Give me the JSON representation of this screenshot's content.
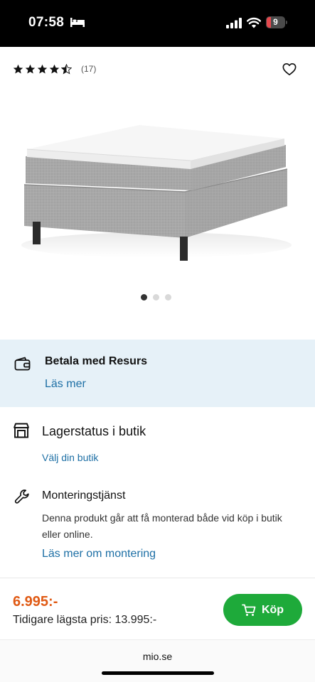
{
  "status_bar": {
    "time": "07:58",
    "battery_level": "9",
    "icons": [
      "bed-icon",
      "signal-icon",
      "wifi-icon",
      "battery-icon"
    ]
  },
  "product": {
    "rating": 4.5,
    "rating_max": 5,
    "review_count": "(17)",
    "favorite_icon": "heart-icon",
    "image": "gray-box-spring-bed",
    "carousel": {
      "count": 3,
      "active_index": 0
    }
  },
  "payment": {
    "title": "Betala med Resurs",
    "link": "Läs mer",
    "icon": "wallet-icon"
  },
  "stock": {
    "title": "Lagerstatus i butik",
    "link": "Välj din butik",
    "icon": "store-icon"
  },
  "assembly": {
    "title": "Monteringstjänst",
    "description": "Denna produkt går att få monterad både vid köp i butik eller online.",
    "link": "Läs mer om montering",
    "icon": "wrench-icon"
  },
  "purchase": {
    "price": "6.995:-",
    "previous_price": "Tidigare lägsta pris: 13.995:-",
    "buy_label": "Köp",
    "buy_icon": "cart-icon"
  },
  "browser": {
    "url": "mio.se"
  },
  "colors": {
    "price": "#e05a14",
    "buy_button": "#1eaa3a",
    "link": "#1d6fa5",
    "info_background": "#e6f1f8"
  }
}
